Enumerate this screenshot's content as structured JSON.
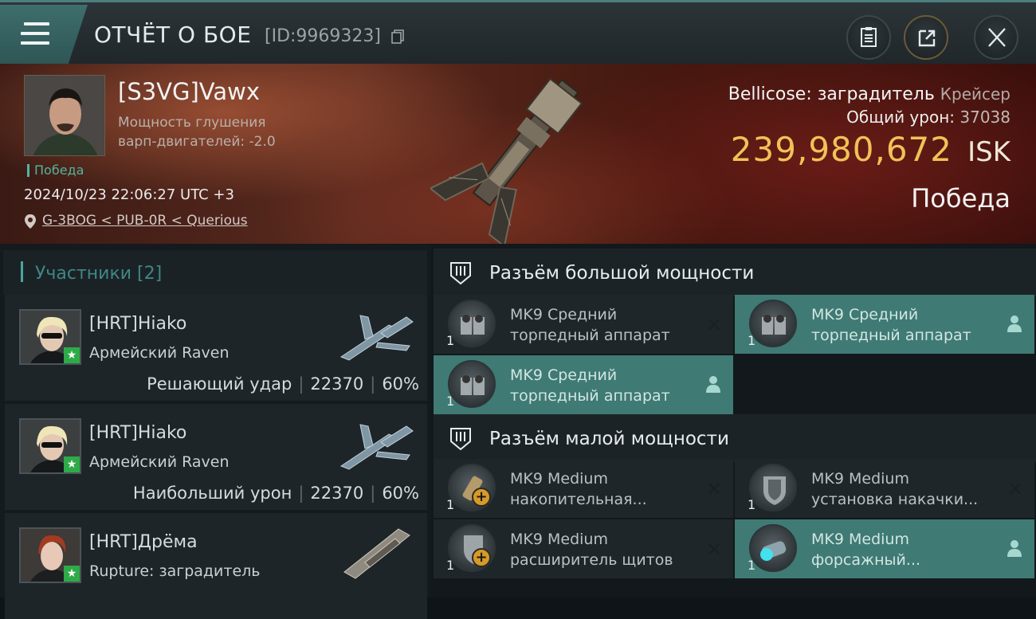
{
  "header": {
    "title": "ОТЧЁТ О БОЕ",
    "report_id": "[ID:9969323]"
  },
  "victim": {
    "name": "[S3VG]Vawx",
    "stat_line1": "Мощность глушения",
    "stat_line2": "варп-двигателей: -2.0",
    "status_tag": "Победа",
    "datetime": "2024/10/23 22:06:27 UTC +3",
    "location": "G-3BOG < PUB-0R < Querious",
    "ship_name": "Bellicose: заградитель",
    "ship_class": "Крейсер",
    "total_damage_label": "Общий урон:",
    "total_damage": "37038",
    "isk_value": "239,980,672",
    "isk_unit": "ISK",
    "result": "Победа"
  },
  "participants": {
    "header": "Участники [2]",
    "items": [
      {
        "name": "[HRT]Hiako",
        "ship": "Армейский Raven",
        "role": "Решающий удар",
        "damage": "22370",
        "percent": "60%"
      },
      {
        "name": "[HRT]Hiako",
        "ship": "Армейский Raven",
        "role": "Наибольший урон",
        "damage": "22370",
        "percent": "60%"
      },
      {
        "name": "[HRT]Дрёма",
        "ship": "Rupture: заградитель"
      }
    ]
  },
  "slots": {
    "high": {
      "title": "Разъём большой мощности",
      "modules": [
        {
          "line1": "MK9 Средний",
          "line2": "торпедный аппарат",
          "qty": "1",
          "state": "destroyed"
        },
        {
          "line1": "MK9 Средний",
          "line2": "торпедный аппарат",
          "qty": "1",
          "state": "dropped"
        },
        {
          "line1": "MK9 Средний",
          "line2": "торпедный аппарат",
          "qty": "1",
          "state": "dropped"
        }
      ]
    },
    "low": {
      "title": "Разъём малой мощности",
      "modules": [
        {
          "line1": "MK9 Medium",
          "line2": "накопительная...",
          "qty": "1",
          "state": "destroyed"
        },
        {
          "line1": "MK9 Medium",
          "line2": "установка накачки...",
          "qty": "1",
          "state": "destroyed"
        },
        {
          "line1": "MK9 Medium",
          "line2": "расширитель щитов",
          "qty": "1",
          "state": "destroyed"
        },
        {
          "line1": "MK9 Medium",
          "line2": "форсажный...",
          "qty": "1",
          "state": "dropped"
        }
      ]
    }
  },
  "colors": {
    "accent": "#4aa7a0",
    "isk": "#f0c257",
    "active_module": "#3f7a74",
    "victory": "#52b59e"
  },
  "icons": [
    "menu-icon",
    "copy-icon",
    "clipboard-icon",
    "share-icon",
    "close-icon",
    "location-pin-icon",
    "high-slot-icon",
    "low-slot-icon",
    "destroyed-x-icon",
    "dropped-person-icon"
  ]
}
